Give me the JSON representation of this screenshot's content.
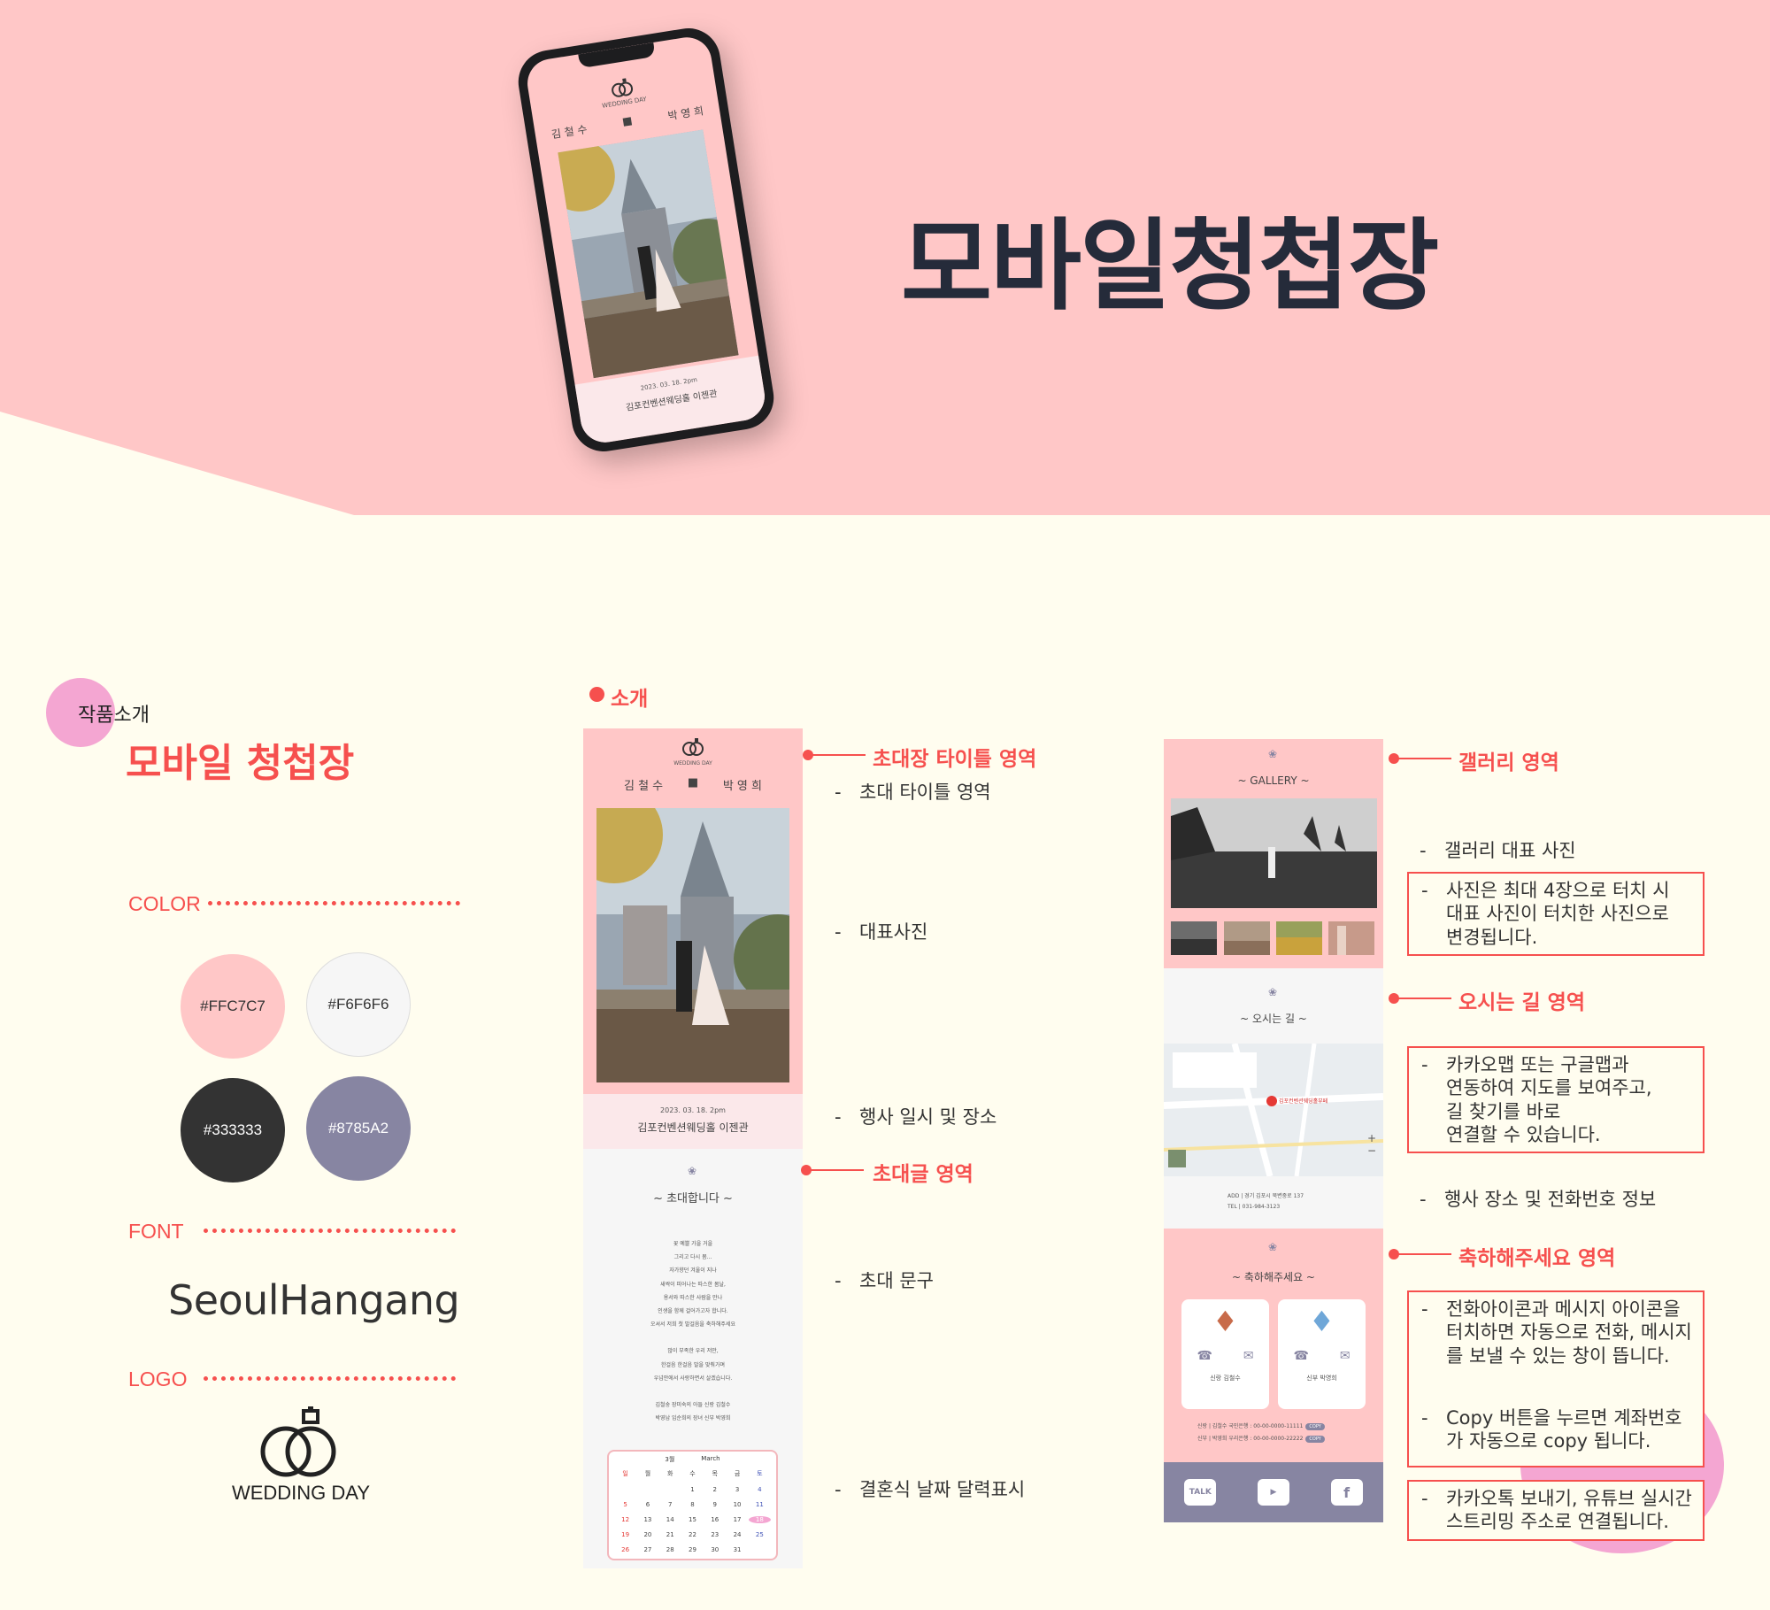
{
  "hero": {
    "title": "모바일청첩장"
  },
  "intro": {
    "label": "작품소개",
    "title": "모바일 청첩장"
  },
  "spec": {
    "color_label": "COLOR",
    "font_label": "FONT",
    "logo_label": "LOGO",
    "colors": [
      "#FFC7C7",
      "#F6F6F6",
      "#333333",
      "#8785A2"
    ],
    "font_sample": "SeoulHangang",
    "logo_text": "WEDDING DAY"
  },
  "section": {
    "title": "소개"
  },
  "mock": {
    "logo_text": "WEDDING DAY",
    "groom_name": "김 철 수",
    "bride_name": "박 영 희",
    "date": "2023. 03. 18. 2pm",
    "venue": "김포컨벤션웨딩홀 이젠관",
    "invite_title": "~ 초대합니다 ~",
    "invite_lines": [
      "꽃 예쁠 가을 거을",
      "그리고 다시 봄...",
      "자가향던 겨울이 지나",
      "새싹이 피어나는 따스한 봄날,",
      "용서와 따스한 사람을 만나",
      "인생을 함께 걸어가고자 합니다.",
      "오셔서 저희 첫 발걸음을 축하해주세요",
      "",
      "많이 부족한 우리 저만,",
      "한걸음 한걸음 발을 맞춰가며",
      "우넘안에서 사랑하면서 살겠습니다.",
      "",
      "김철숭 장미숙의 아들   신랑 김철수",
      "박영남 임순희의 장녀   신부 박영희"
    ],
    "calendar_month_num": "3월",
    "calendar_month_en": "March",
    "calendar_weekdays": [
      "일",
      "월",
      "화",
      "수",
      "목",
      "금",
      "토"
    ],
    "calendar_days": [
      "",
      "",
      "",
      "1",
      "2",
      "3",
      "4",
      "5",
      "6",
      "7",
      "8",
      "9",
      "10",
      "11",
      "12",
      "13",
      "14",
      "15",
      "16",
      "17",
      "18",
      "19",
      "20",
      "21",
      "22",
      "23",
      "24",
      "25",
      "26",
      "27",
      "28",
      "29",
      "30",
      "31",
      ""
    ],
    "gallery_title": "~ GALLERY ~",
    "directions_title": "~ 오시는 길 ~",
    "map_place": "김포컨벤션웨딩홀부페",
    "address": "ADD | 경기 김포시 북변중로 137",
    "tel": "TEL | 031-984-3123",
    "congrats_title": "~ 축하해주세요 ~",
    "groom_card": "신랑 김철수",
    "bride_card": "신부 박영희",
    "groom_account": "신랑 | 김철수 국민은행 : 00-00-0000-11111",
    "bride_account": "신부 | 박영희 우리은행 : 00-00-0000-22222",
    "copy_label": "COPY",
    "sns": [
      "TALK",
      "▶",
      "f"
    ]
  },
  "callouts": {
    "title_area": "초대장 타이틀 영역",
    "title_area_note": "초대 타이틀 영역",
    "photo_note": "대표사진",
    "date_note": "행사 일시 및 장소",
    "invite_area": "초대글 영역",
    "invite_note": "초대 문구",
    "calendar_note": "결혼식 날짜 달력표시",
    "gallery_area": "갤러리 영역",
    "gallery_note": "갤러리 대표 사진",
    "gallery_box": [
      "사진은 최대 4장으로 터치 시",
      "대표 사진이 터치한 사진으로",
      "변경됩니다."
    ],
    "directions_area": "오시는 길 영역",
    "directions_box": [
      "카카오맵 또는 구글맵과",
      "연동하여 지도를 보여주고,",
      "길 찾기를 바로",
      "연결할 수 있습니다."
    ],
    "venue_note": "행사 장소 및 전화번호 정보",
    "congrats_area": "축하해주세요 영역",
    "congrats_box_1": [
      "전화아이콘과 메시지 아이콘을",
      "터치하면 자동으로 전화, 메시지",
      "를 보낼 수 있는 창이 뜹니다."
    ],
    "congrats_box_2": [
      "Copy 버튼을 누르면 계좌번호",
      "가 자동으로 copy 됩니다."
    ],
    "sns_box": [
      "카카오톡 보내기, 유튜브 실시간",
      "스트리밍 주소로 연결됩니다."
    ]
  }
}
